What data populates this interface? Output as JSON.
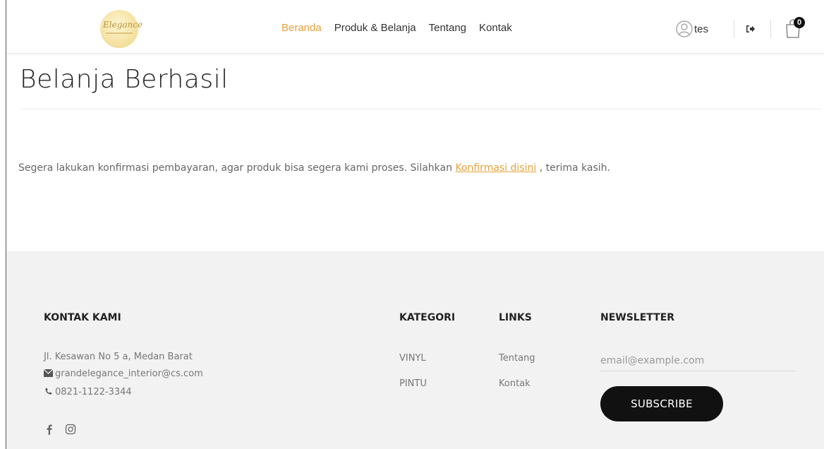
{
  "header": {
    "logo_text": "Elegance",
    "nav": [
      {
        "label": "Beranda",
        "active": true
      },
      {
        "label": "Produk & Belanja",
        "active": false
      },
      {
        "label": "Tentang",
        "active": false
      },
      {
        "label": "Kontak",
        "active": false
      }
    ],
    "user_name": "tes",
    "cart_count": "0",
    "icons": [
      "user-icon",
      "logout-icon",
      "cart-icon"
    ]
  },
  "main": {
    "title": "Belanja Berhasil",
    "message_before": "Segera lakukan konfirmasi pembayaran, agar produk bisa segera kami proses. Silahkan ",
    "confirm_link": "Konfirmasi disini",
    "message_after": " , terima kasih."
  },
  "footer": {
    "contact": {
      "heading": "KONTAK KAMI",
      "address": "Jl. Kesawan No 5 a, Medan Barat",
      "email": "grandelegance_interior@cs.com",
      "phone": "0821-1122-3344"
    },
    "kategori": {
      "heading": "KATEGORI",
      "items": [
        "VINYL",
        "PINTU"
      ]
    },
    "links": {
      "heading": "LINKS",
      "items": [
        "Tentang",
        "Kontak"
      ]
    },
    "newsletter": {
      "heading": "NEWSLETTER",
      "placeholder": "email@example.com",
      "button": "SUBSCRIBE"
    },
    "social": [
      "facebook-icon",
      "instagram-icon"
    ]
  },
  "colors": {
    "accent": "#e6a23c",
    "footer_bg": "#f2f2f2",
    "button_bg": "#111111"
  }
}
